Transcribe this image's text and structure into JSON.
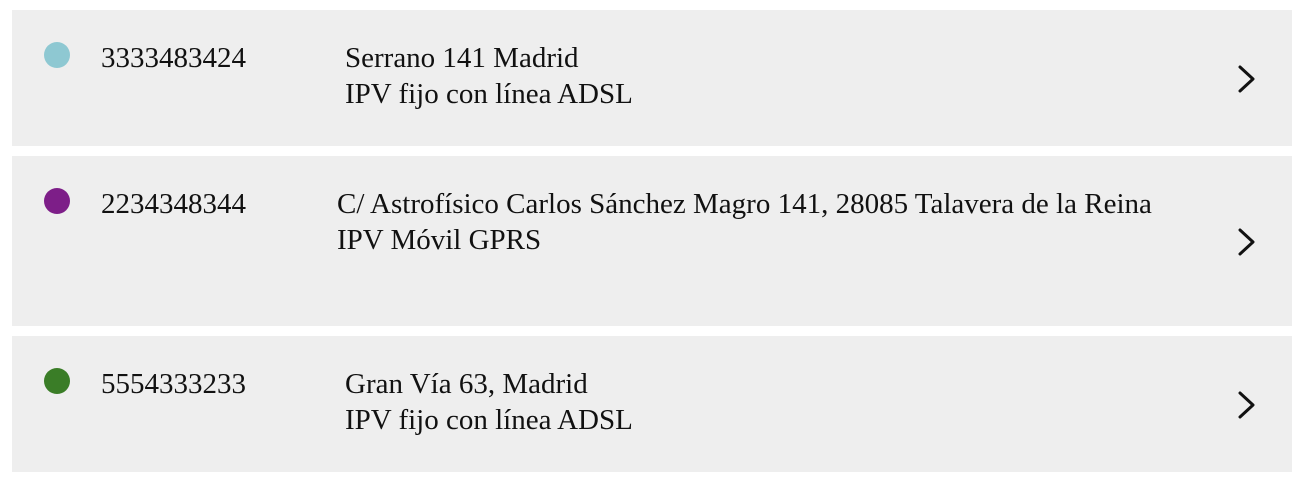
{
  "lines": [
    {
      "number": "3333483424",
      "address": "Serrano 141 Madrid",
      "service": "IPV fijo con línea ADSL",
      "status_color": "#8ec8d2",
      "chevron_icon": "chevron-right-icon"
    },
    {
      "number": "2234348344",
      "address": "C/ Astrofísico Carlos Sánchez Magro 141, 28085 Talavera de la Reina",
      "service": "IPV Móvil GPRS",
      "status_color": "#7d1e88",
      "chevron_icon": "chevron-right-icon"
    },
    {
      "number": "5554333233",
      "address": "Gran Vía 63, Madrid",
      "service": "IPV fijo con línea ADSL",
      "status_color": "#3a7d27",
      "chevron_icon": "chevron-right-icon"
    }
  ],
  "colors": {
    "card_background": "#eeeeee",
    "text": "#111111"
  }
}
